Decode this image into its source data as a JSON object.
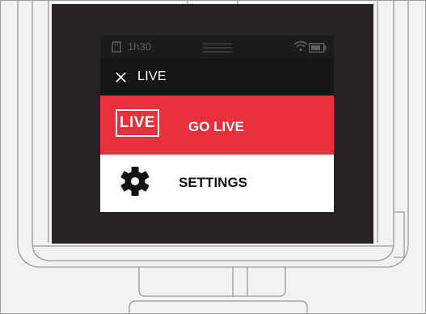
{
  "status_bar": {
    "storage_icon": "sd-card-icon",
    "time_remaining": "1h30",
    "menu_icon": "hamburger-menu-icon",
    "wifi_icon": "wifi-icon",
    "battery_icon": "battery-icon"
  },
  "header": {
    "close_icon": "close-icon",
    "title": "LIVE"
  },
  "menu": {
    "items": [
      {
        "badge": "LIVE",
        "label": "GO LIVE",
        "background": "#e8303c",
        "text_color": "#ffffff"
      },
      {
        "icon": "gear-icon",
        "label": "SETTINGS",
        "background": "#ffffff",
        "text_color": "#111111"
      }
    ]
  },
  "colors": {
    "device_frame": "#272323",
    "screen_background": "#1b1b1b",
    "accent": "#e8303c",
    "line_art": "#9a9a9a"
  }
}
